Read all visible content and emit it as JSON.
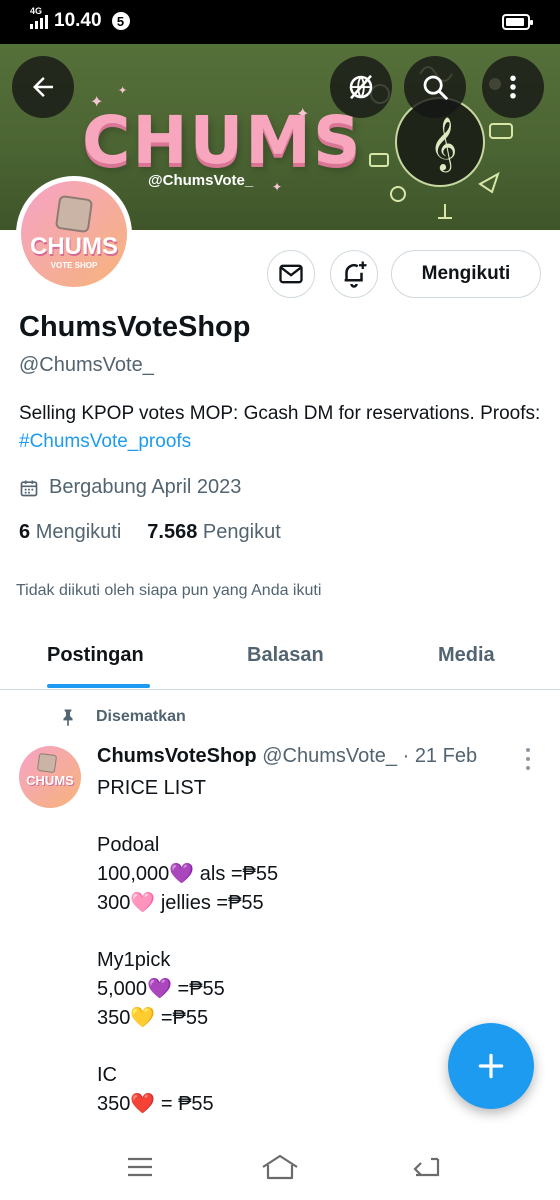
{
  "status_bar": {
    "network": "4G",
    "time": "10.40",
    "notification_count": "5",
    "battery_level": 0.9
  },
  "banner": {
    "wordmark": "CHUMS",
    "handle": "@ChumsVote_"
  },
  "avatar": {
    "wordmark": "CHUMS",
    "subtitle": "VOTE SHOP"
  },
  "profile": {
    "follow_label": "Mengikuti",
    "display_name": "ChumsVoteShop",
    "username": "@ChumsVote_",
    "bio_text": "Selling KPOP votes MOP: Gcash DM for reservations. Proofs: ",
    "bio_hashtag": "#ChumsVote_proofs",
    "joined": "Bergabung April 2023",
    "following_count": "6",
    "following_label": "Mengikuti",
    "followers_count": "7.568",
    "followers_label": "Pengikut",
    "not_followed_note": "Tidak diikuti oleh siapa pun yang Anda ikuti"
  },
  "tabs": [
    {
      "label": "Postingan",
      "active": true
    },
    {
      "label": "Balasan",
      "active": false
    },
    {
      "label": "Media",
      "active": false
    }
  ],
  "post": {
    "pinned_label": "Disematkan",
    "author_name": "ChumsVoteShop",
    "author_handle": "@ChumsVote_",
    "separator": " · ",
    "date": "21 Feb",
    "avatar_wordmark": "CHUMS",
    "body": "PRICE LIST\n\nPodoal\n100,000💜 als =₱55\n300🩷 jellies =₱55\n\nMy1pick\n5,000💜 =₱55\n350💛 =₱55\n\nIC\n350❤️ = ₱55"
  },
  "colors": {
    "accent": "#1d9bf0",
    "text_primary": "#0f1419",
    "text_secondary": "#536471",
    "banner_green": "#4a6332",
    "brand_pink": "#f7a6be"
  },
  "icons": {
    "back": "arrow-left-icon",
    "no_translate": "slashed-globe-icon",
    "search": "search-icon",
    "more": "more-vertical-icon",
    "message": "envelope-icon",
    "notify": "bell-plus-icon",
    "calendar": "calendar-icon",
    "pin": "pin-icon",
    "compose": "plus-icon",
    "nav_menu": "menu-icon",
    "nav_home": "home-icon",
    "nav_back": "back-icon"
  }
}
